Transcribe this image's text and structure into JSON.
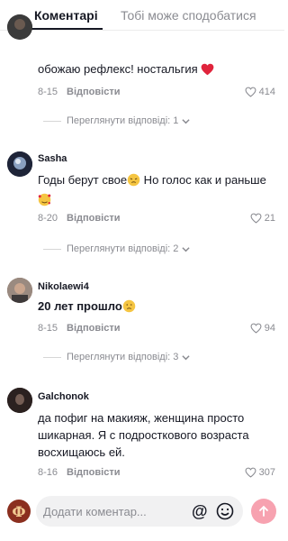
{
  "tabs": [
    {
      "label": "Коментарі"
    },
    {
      "label": "Тобі може сподобатися"
    }
  ],
  "comments": [
    {
      "username": "",
      "text": "обожаю рефлекс! ностальгия",
      "date": "8-15",
      "reply_label": "Відповісти",
      "likes": "414",
      "view_replies": "Переглянути відповіді: 1"
    },
    {
      "username": "Sasha",
      "text_line1": "Годы берут свое",
      "text_line1b": " Но голос как и раньше",
      "date": "8-20",
      "reply_label": "Відповісти",
      "likes": "21",
      "view_replies": "Переглянути відповіді: 2"
    },
    {
      "username": "Nikolaewi4",
      "text": "20 лет прошло",
      "date": "8-15",
      "reply_label": "Відповісти",
      "likes": "94",
      "view_replies": "Переглянути відповіді: 3"
    },
    {
      "username": "Galchonok",
      "text_lines": [
        "да пофиг на макияж, женщина просто",
        "шикарная. Я с подросткового возраста",
        "восхищаюсь ей."
      ],
      "date": "8-16",
      "reply_label": "Відповісти",
      "likes": "307"
    }
  ],
  "composer": {
    "placeholder": "Додати коментар...",
    "at_symbol": "@",
    "avatar_letter": "Ф"
  },
  "colors": {
    "text": "#161823",
    "muted": "#8a8b91",
    "heart_red": "#e0243c",
    "send_pink": "#f7a2b0"
  }
}
